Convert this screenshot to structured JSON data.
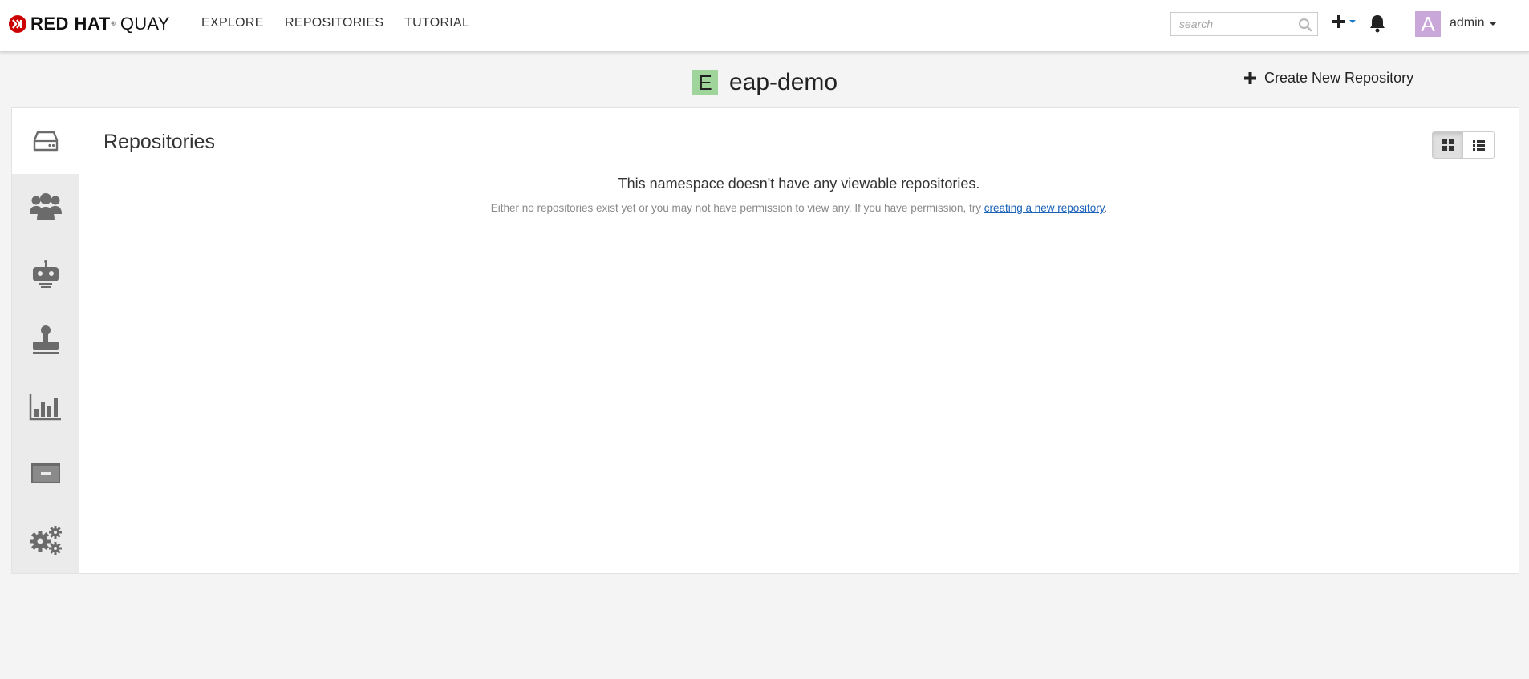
{
  "header": {
    "brand_bold": "RED HAT",
    "brand_reg": "®",
    "brand_light": "QUAY",
    "nav": [
      {
        "label": "EXPLORE"
      },
      {
        "label": "REPOSITORIES"
      },
      {
        "label": "TUTORIAL"
      }
    ],
    "search": {
      "placeholder": "search",
      "value": ""
    },
    "user": {
      "avatar_letter": "A",
      "name": "admin"
    }
  },
  "namespace": {
    "letter": "E",
    "name": "eap-demo",
    "letter_color": "#9fd49a"
  },
  "actions": {
    "create_repo_label": "Create New Repository"
  },
  "sidebar": {
    "tabs": [
      {
        "icon": "hard-drive-icon",
        "active": true
      },
      {
        "icon": "users-icon",
        "active": false
      },
      {
        "icon": "robot-icon",
        "active": false
      },
      {
        "icon": "stamp-icon",
        "active": false
      },
      {
        "icon": "bar-chart-icon",
        "active": false
      },
      {
        "icon": "archive-icon",
        "active": false
      },
      {
        "icon": "gears-icon",
        "active": false
      }
    ]
  },
  "main": {
    "section_title": "Repositories",
    "empty_title": "This namespace doesn't have any viewable repositories.",
    "empty_desc_prefix": "Either no repositories exist yet or you may not have permission to view any. If you have permission, try ",
    "empty_desc_link": "creating a new repository",
    "empty_desc_suffix": "."
  },
  "colors": {
    "brand_red": "#cc0000",
    "link": "#1a62b8",
    "avatar": "#c9a7d8"
  }
}
